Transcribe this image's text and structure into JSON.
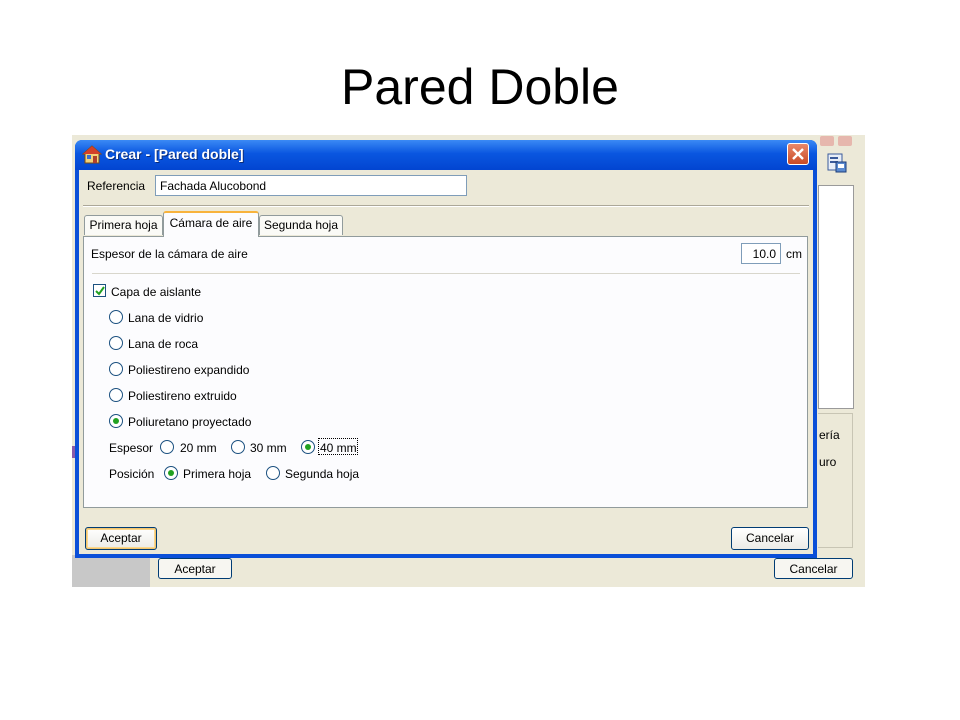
{
  "slide": {
    "title": "Pared Doble"
  },
  "background_window": {
    "text_1": "ería",
    "text_2": "uro",
    "accept_label": "Aceptar",
    "cancel_label": "Cancelar"
  },
  "dialog": {
    "title": "Crear - [Pared doble]",
    "reference": {
      "label": "Referencia",
      "value": "Fachada Alucobond"
    },
    "tabs": [
      {
        "label": "Primera hoja",
        "active": false
      },
      {
        "label": "Cámara de aire",
        "active": true
      },
      {
        "label": "Segunda hoja",
        "active": false
      }
    ],
    "air_chamber": {
      "thickness_label": "Espesor de la cámara de aire",
      "thickness_value": "10.0",
      "thickness_unit": "cm"
    },
    "insulation": {
      "checkbox_label": "Capa de aislante",
      "checked": true,
      "materials": [
        {
          "label": "Lana de vidrio",
          "selected": false
        },
        {
          "label": "Lana de roca",
          "selected": false
        },
        {
          "label": "Poliestireno expandido",
          "selected": false
        },
        {
          "label": "Poliestireno extruido",
          "selected": false
        },
        {
          "label": "Poliuretano proyectado",
          "selected": true
        }
      ],
      "thickness": {
        "label": "Espesor",
        "options": [
          {
            "label": "20 mm",
            "selected": false
          },
          {
            "label": "30 mm",
            "selected": false
          },
          {
            "label": "40 mm",
            "selected": true
          }
        ]
      },
      "position": {
        "label": "Posición",
        "options": [
          {
            "label": "Primera hoja",
            "selected": true
          },
          {
            "label": "Segunda hoja",
            "selected": false
          }
        ]
      }
    },
    "accept_label": "Aceptar",
    "cancel_label": "Cancelar"
  },
  "colors": {
    "titlebar": "#0a56e0",
    "dialog_face": "#ece9d8",
    "radio_dot": "#21a121",
    "tab_highlight": "#f8b33c"
  }
}
